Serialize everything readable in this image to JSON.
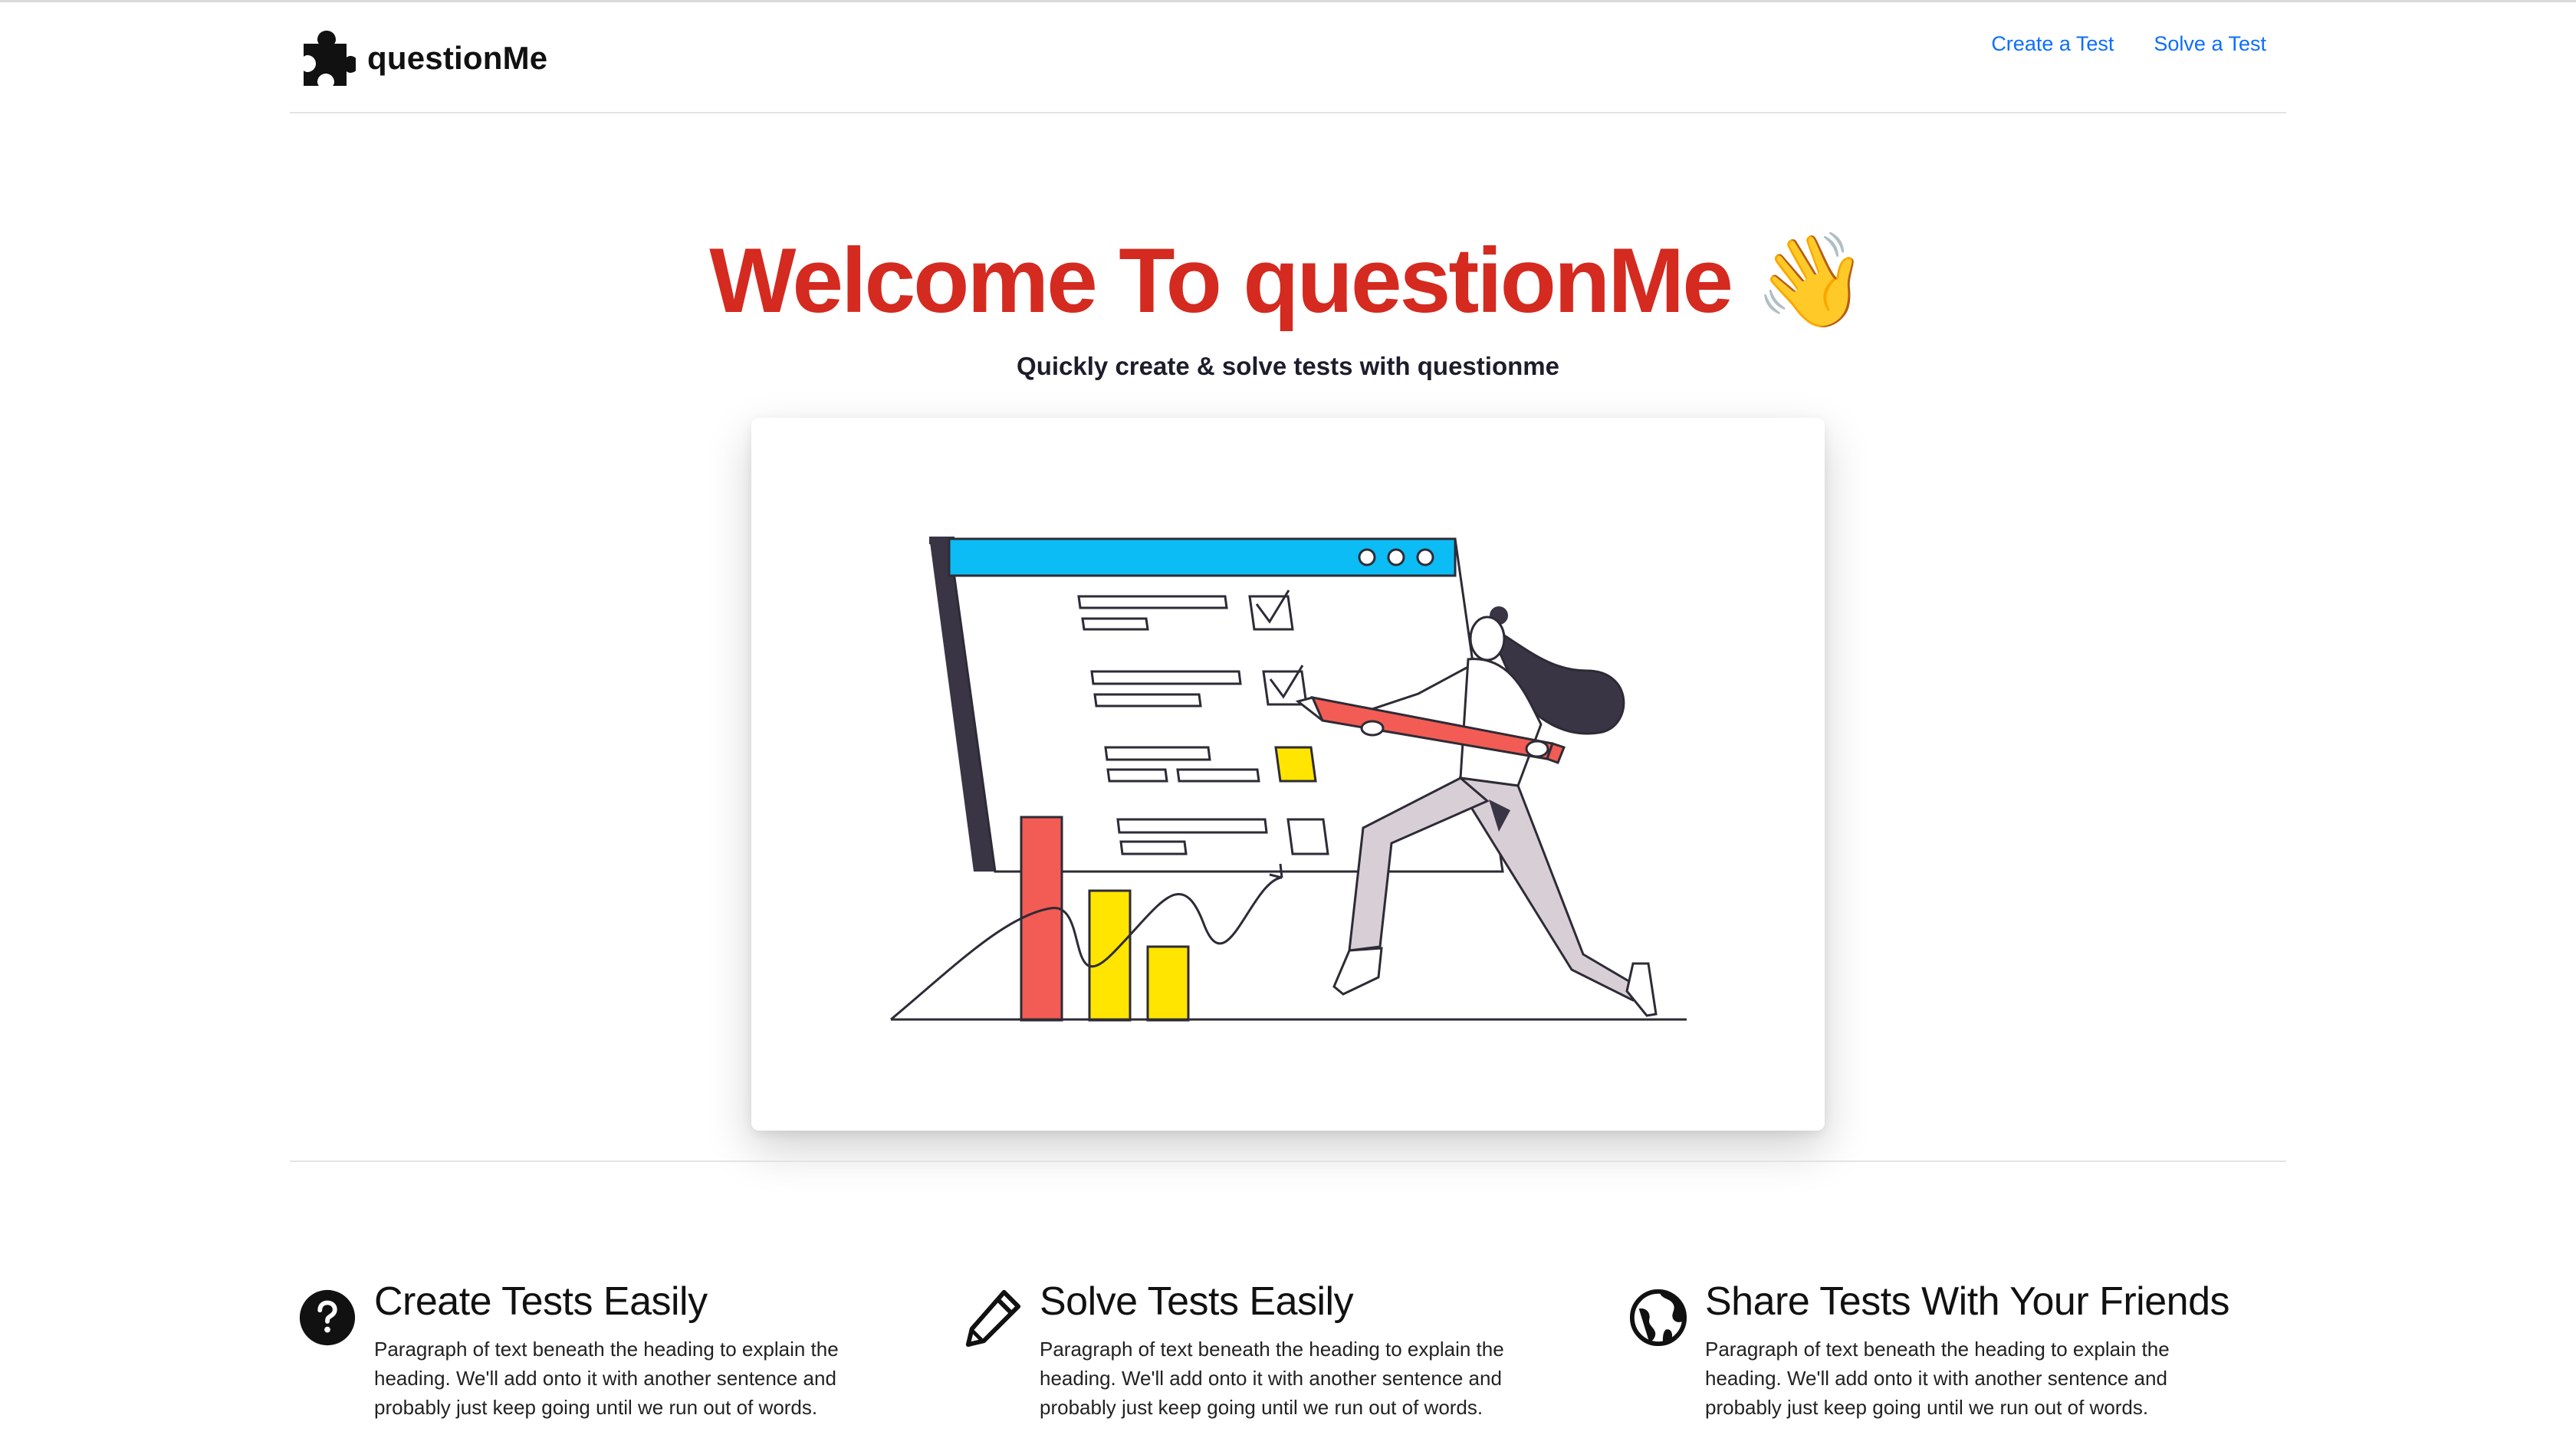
{
  "brand": {
    "name": "questionMe",
    "icon": "puzzle-piece-icon"
  },
  "nav": {
    "links": [
      "Create a Test",
      "Solve a Test"
    ]
  },
  "hero": {
    "title": "Welcome To questionMe 👋",
    "subtitle": "Quickly create & solve tests with questionme",
    "illustration": "person-checking-test-illustration"
  },
  "features": [
    {
      "icon": "question-circle-icon",
      "title": "Create Tests Easily",
      "text": "Paragraph of text beneath the heading to explain the heading. We'll add onto it with another sentence and probably just keep going until we run out of words."
    },
    {
      "icon": "pencil-icon",
      "title": "Solve Tests Easily",
      "text": "Paragraph of text beneath the heading to explain the heading. We'll add onto it with another sentence and probably just keep going until we run out of words."
    },
    {
      "icon": "globe-icon",
      "title": "Share Tests With Your Friends",
      "text": "Paragraph of text beneath the heading to explain the heading. We'll add onto it with another sentence and probably just keep going until we run out of words."
    }
  ],
  "colors": {
    "accent": "#d42a20",
    "link": "#0d6efd",
    "illustration_red": "#f25c54",
    "illustration_yellow": "#ffe500",
    "illustration_blue": "#0bbcf5"
  }
}
